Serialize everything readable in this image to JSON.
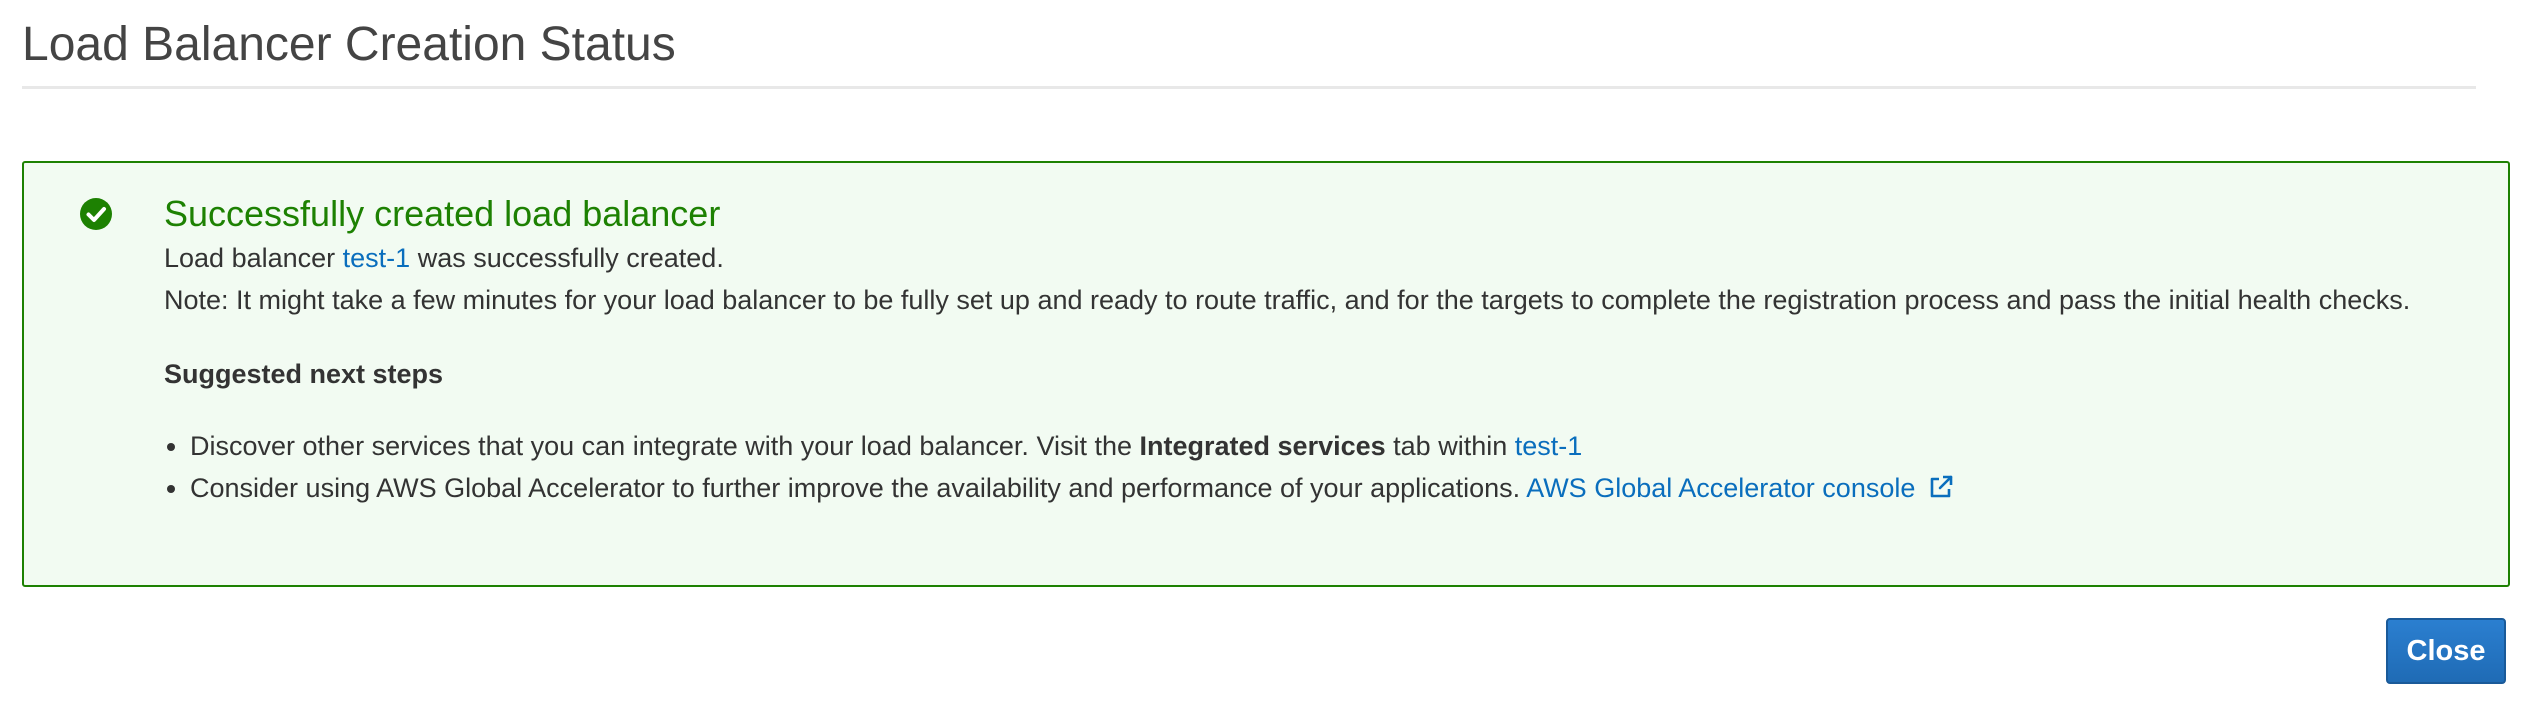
{
  "page": {
    "title": "Load Balancer Creation Status"
  },
  "alert": {
    "status": "success",
    "icon": "check-circle-icon",
    "heading": "Successfully created load balancer",
    "created_prefix": "Load balancer",
    "load_balancer_name": "test-1",
    "created_suffix": "was successfully created.",
    "note": "Note: It might take a few minutes for your load balancer to be fully set up and ready to route traffic, and for the targets to complete the registration process and pass the initial health checks."
  },
  "next_steps": {
    "heading": "Suggested next steps",
    "step1": {
      "prefix": "Discover other services that you can integrate with your load balancer. Visit the",
      "bold": "Integrated services",
      "middle": "tab within",
      "link": "test-1"
    },
    "step2": {
      "prefix": "Consider using AWS Global Accelerator to further improve the availability and performance of your applications.",
      "link": "AWS Global Accelerator console",
      "link_icon": "external-link-icon"
    }
  },
  "footer": {
    "close_label": "Close"
  },
  "colors": {
    "success_green": "#1d8102",
    "success_bg": "#f2fbf2",
    "link_blue": "#0a6ebd",
    "primary_button": "#1f6bb5"
  }
}
